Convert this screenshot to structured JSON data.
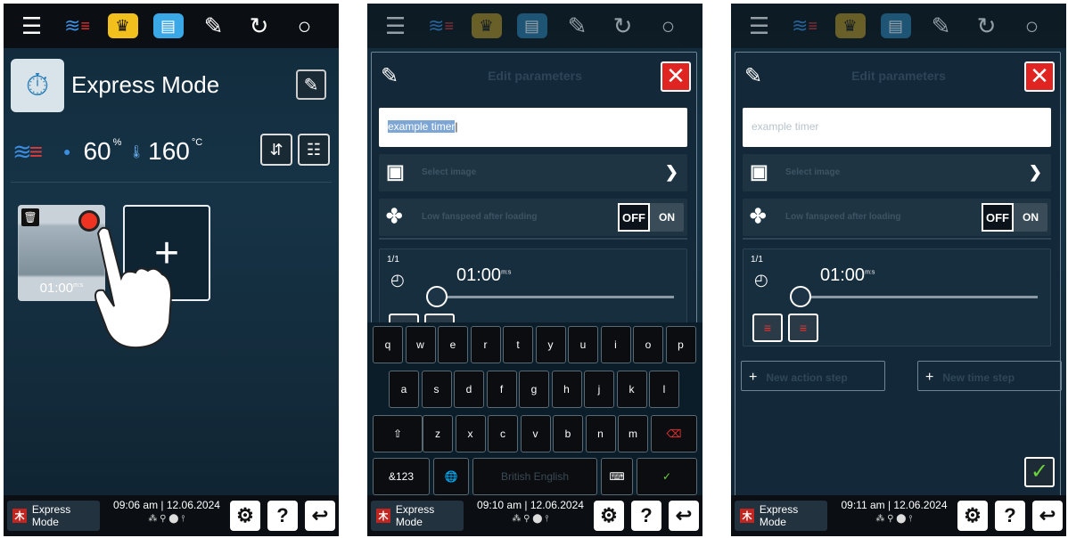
{
  "topbar_icons": [
    "list-icon",
    "steam-icon",
    "chef-hat-icon",
    "tray-icon",
    "edit-list-icon",
    "cycle-icon",
    "search-icon"
  ],
  "bottombar": {
    "mode_label": "Express Mode",
    "logo_char": "木",
    "screens": [
      {
        "time": "09:06 am | 12.06.2024"
      },
      {
        "time": "09:10 am | 12.06.2024"
      },
      {
        "time": "09:11 am | 12.06.2024"
      }
    ],
    "status_icons": "⁂ ⚲ ⬤ ⫯",
    "help": "?"
  },
  "screen1": {
    "title": "Express Mode",
    "humidity": "60",
    "humidity_unit": "%",
    "temperature": "160",
    "temperature_unit": "°C",
    "timer_card": {
      "time": "01:00",
      "time_unit": "m:s"
    },
    "add_label": "+"
  },
  "editor": {
    "title": "Edit parameters",
    "name_value": "example timer",
    "select_image": "Select image",
    "fan_label": "Low fanspeed after loading",
    "toggle_off": "OFF",
    "toggle_on": "ON",
    "step_count": "1/1",
    "step_time": "01:00",
    "step_time_unit": "m:s",
    "slider_fraction": 0.0,
    "new_action": "New action step",
    "new_time": "New time step"
  },
  "keyboard": {
    "row1": [
      "q",
      "w",
      "e",
      "r",
      "t",
      "y",
      "u",
      "i",
      "o",
      "p"
    ],
    "row2": [
      "a",
      "s",
      "d",
      "f",
      "g",
      "h",
      "j",
      "k",
      "l"
    ],
    "row3": [
      "z",
      "x",
      "c",
      "v",
      "b",
      "n",
      "m"
    ],
    "num_key": "&123",
    "space_label": "British English"
  },
  "colors": {
    "accent_red": "#e02421",
    "confirm_green": "#6cd33a",
    "steam_blue": "#3b8de0"
  }
}
